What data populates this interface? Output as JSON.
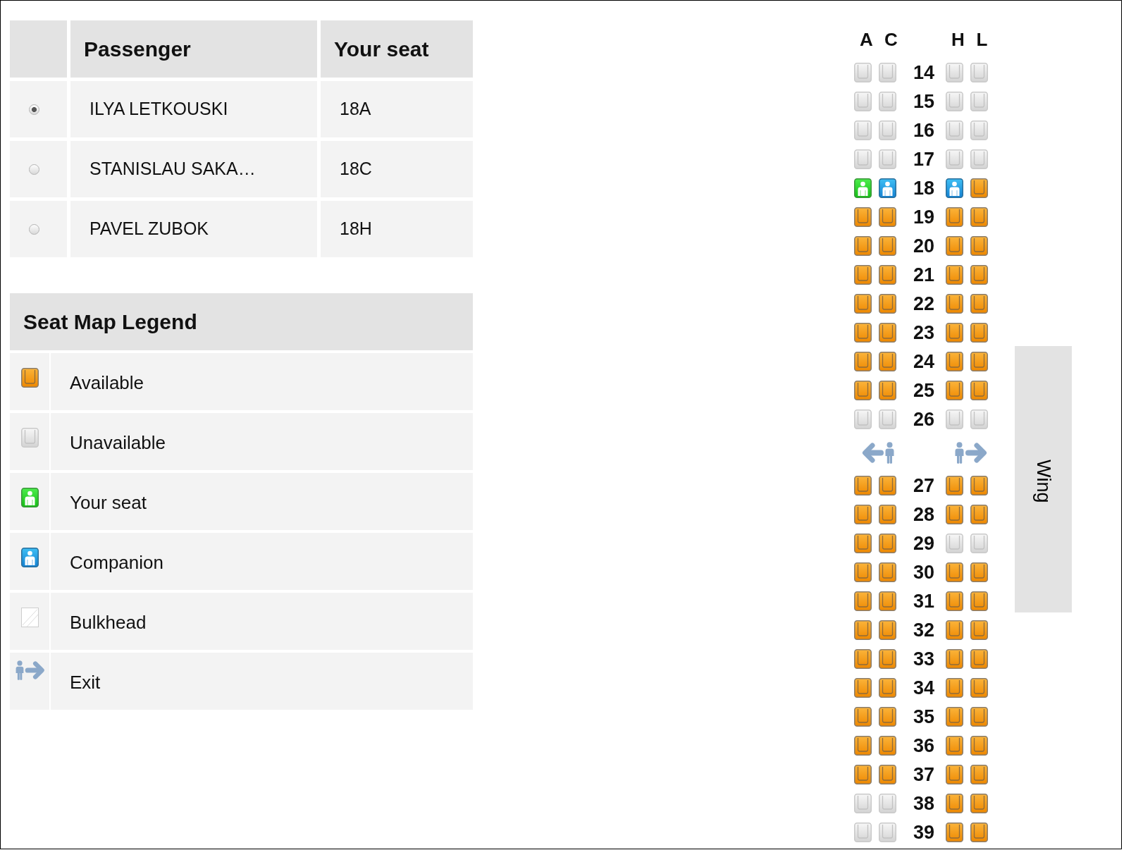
{
  "passengers": {
    "columns": [
      "Passenger",
      "Your seat"
    ],
    "rows": [
      {
        "selected": true,
        "name": "ILYA LETKOUSKI",
        "seat": "18A"
      },
      {
        "selected": false,
        "name": "STANISLAU SAKA…",
        "seat": "18C"
      },
      {
        "selected": false,
        "name": "PAVEL ZUBOK",
        "seat": "18H"
      }
    ]
  },
  "legend": {
    "title": "Seat Map Legend",
    "items": [
      {
        "kind": "available",
        "label": "Available"
      },
      {
        "kind": "unavailable",
        "label": "Unavailable"
      },
      {
        "kind": "your_seat",
        "label": "Your seat"
      },
      {
        "kind": "companion",
        "label": "Companion"
      },
      {
        "kind": "bulkhead",
        "label": "Bulkhead"
      },
      {
        "kind": "exit",
        "label": "Exit"
      }
    ]
  },
  "seat_map": {
    "left_columns": [
      "A",
      "C"
    ],
    "right_columns": [
      "H",
      "L"
    ],
    "rows": [
      {
        "kind": "seats",
        "number": "14",
        "seats": [
          {
            "kind": "unavailable"
          },
          {
            "kind": "unavailable"
          },
          {
            "kind": "unavailable"
          },
          {
            "kind": "unavailable"
          }
        ]
      },
      {
        "kind": "seats",
        "number": "15",
        "seats": [
          {
            "kind": "unavailable"
          },
          {
            "kind": "unavailable"
          },
          {
            "kind": "unavailable"
          },
          {
            "kind": "unavailable"
          }
        ]
      },
      {
        "kind": "seats",
        "number": "16",
        "seats": [
          {
            "kind": "unavailable"
          },
          {
            "kind": "unavailable"
          },
          {
            "kind": "unavailable"
          },
          {
            "kind": "unavailable"
          }
        ]
      },
      {
        "kind": "seats",
        "number": "17",
        "seats": [
          {
            "kind": "unavailable"
          },
          {
            "kind": "unavailable"
          },
          {
            "kind": "unavailable"
          },
          {
            "kind": "unavailable"
          }
        ]
      },
      {
        "kind": "seats",
        "number": "18",
        "seats": [
          {
            "kind": "your_seat"
          },
          {
            "kind": "companion"
          },
          {
            "kind": "companion"
          },
          {
            "kind": "available"
          }
        ]
      },
      {
        "kind": "seats",
        "number": "19",
        "seats": [
          {
            "kind": "available"
          },
          {
            "kind": "available"
          },
          {
            "kind": "available"
          },
          {
            "kind": "available"
          }
        ]
      },
      {
        "kind": "seats",
        "number": "20",
        "seats": [
          {
            "kind": "available"
          },
          {
            "kind": "available"
          },
          {
            "kind": "available"
          },
          {
            "kind": "available"
          }
        ]
      },
      {
        "kind": "seats",
        "number": "21",
        "seats": [
          {
            "kind": "available"
          },
          {
            "kind": "available"
          },
          {
            "kind": "available"
          },
          {
            "kind": "available"
          }
        ]
      },
      {
        "kind": "seats",
        "number": "22",
        "seats": [
          {
            "kind": "available"
          },
          {
            "kind": "available"
          },
          {
            "kind": "available"
          },
          {
            "kind": "available"
          }
        ]
      },
      {
        "kind": "seats",
        "number": "23",
        "seats": [
          {
            "kind": "available"
          },
          {
            "kind": "available"
          },
          {
            "kind": "available"
          },
          {
            "kind": "available"
          }
        ]
      },
      {
        "kind": "seats",
        "number": "24",
        "seats": [
          {
            "kind": "available"
          },
          {
            "kind": "available"
          },
          {
            "kind": "available"
          },
          {
            "kind": "available"
          }
        ]
      },
      {
        "kind": "seats",
        "number": "25",
        "seats": [
          {
            "kind": "available"
          },
          {
            "kind": "available"
          },
          {
            "kind": "available"
          },
          {
            "kind": "available"
          }
        ]
      },
      {
        "kind": "seats",
        "number": "26",
        "seats": [
          {
            "kind": "unavailable"
          },
          {
            "kind": "unavailable"
          },
          {
            "kind": "unavailable"
          },
          {
            "kind": "unavailable"
          }
        ]
      },
      {
        "kind": "exit"
      },
      {
        "kind": "seats",
        "number": "27",
        "seats": [
          {
            "kind": "available"
          },
          {
            "kind": "available"
          },
          {
            "kind": "available"
          },
          {
            "kind": "available"
          }
        ]
      },
      {
        "kind": "seats",
        "number": "28",
        "seats": [
          {
            "kind": "available"
          },
          {
            "kind": "available"
          },
          {
            "kind": "available"
          },
          {
            "kind": "available"
          }
        ]
      },
      {
        "kind": "seats",
        "number": "29",
        "seats": [
          {
            "kind": "available"
          },
          {
            "kind": "available"
          },
          {
            "kind": "unavailable"
          },
          {
            "kind": "unavailable"
          }
        ]
      },
      {
        "kind": "seats",
        "number": "30",
        "seats": [
          {
            "kind": "available"
          },
          {
            "kind": "available"
          },
          {
            "kind": "available"
          },
          {
            "kind": "available"
          }
        ]
      },
      {
        "kind": "seats",
        "number": "31",
        "seats": [
          {
            "kind": "available"
          },
          {
            "kind": "available"
          },
          {
            "kind": "available"
          },
          {
            "kind": "available"
          }
        ]
      },
      {
        "kind": "seats",
        "number": "32",
        "seats": [
          {
            "kind": "available"
          },
          {
            "kind": "available"
          },
          {
            "kind": "available"
          },
          {
            "kind": "available"
          }
        ]
      },
      {
        "kind": "seats",
        "number": "33",
        "seats": [
          {
            "kind": "available"
          },
          {
            "kind": "available"
          },
          {
            "kind": "available"
          },
          {
            "kind": "available"
          }
        ]
      },
      {
        "kind": "seats",
        "number": "34",
        "seats": [
          {
            "kind": "available"
          },
          {
            "kind": "available"
          },
          {
            "kind": "available"
          },
          {
            "kind": "available"
          }
        ]
      },
      {
        "kind": "seats",
        "number": "35",
        "seats": [
          {
            "kind": "available"
          },
          {
            "kind": "available"
          },
          {
            "kind": "available"
          },
          {
            "kind": "available"
          }
        ]
      },
      {
        "kind": "seats",
        "number": "36",
        "seats": [
          {
            "kind": "available"
          },
          {
            "kind": "available"
          },
          {
            "kind": "available"
          },
          {
            "kind": "available"
          }
        ]
      },
      {
        "kind": "seats",
        "number": "37",
        "seats": [
          {
            "kind": "available"
          },
          {
            "kind": "available"
          },
          {
            "kind": "available"
          },
          {
            "kind": "available"
          }
        ]
      },
      {
        "kind": "seats",
        "number": "38",
        "seats": [
          {
            "kind": "unavailable"
          },
          {
            "kind": "unavailable"
          },
          {
            "kind": "available"
          },
          {
            "kind": "available"
          }
        ]
      },
      {
        "kind": "seats",
        "number": "39",
        "seats": [
          {
            "kind": "unavailable"
          },
          {
            "kind": "unavailable"
          },
          {
            "kind": "available"
          },
          {
            "kind": "available"
          }
        ]
      }
    ]
  },
  "wing": {
    "label": "Wing"
  }
}
